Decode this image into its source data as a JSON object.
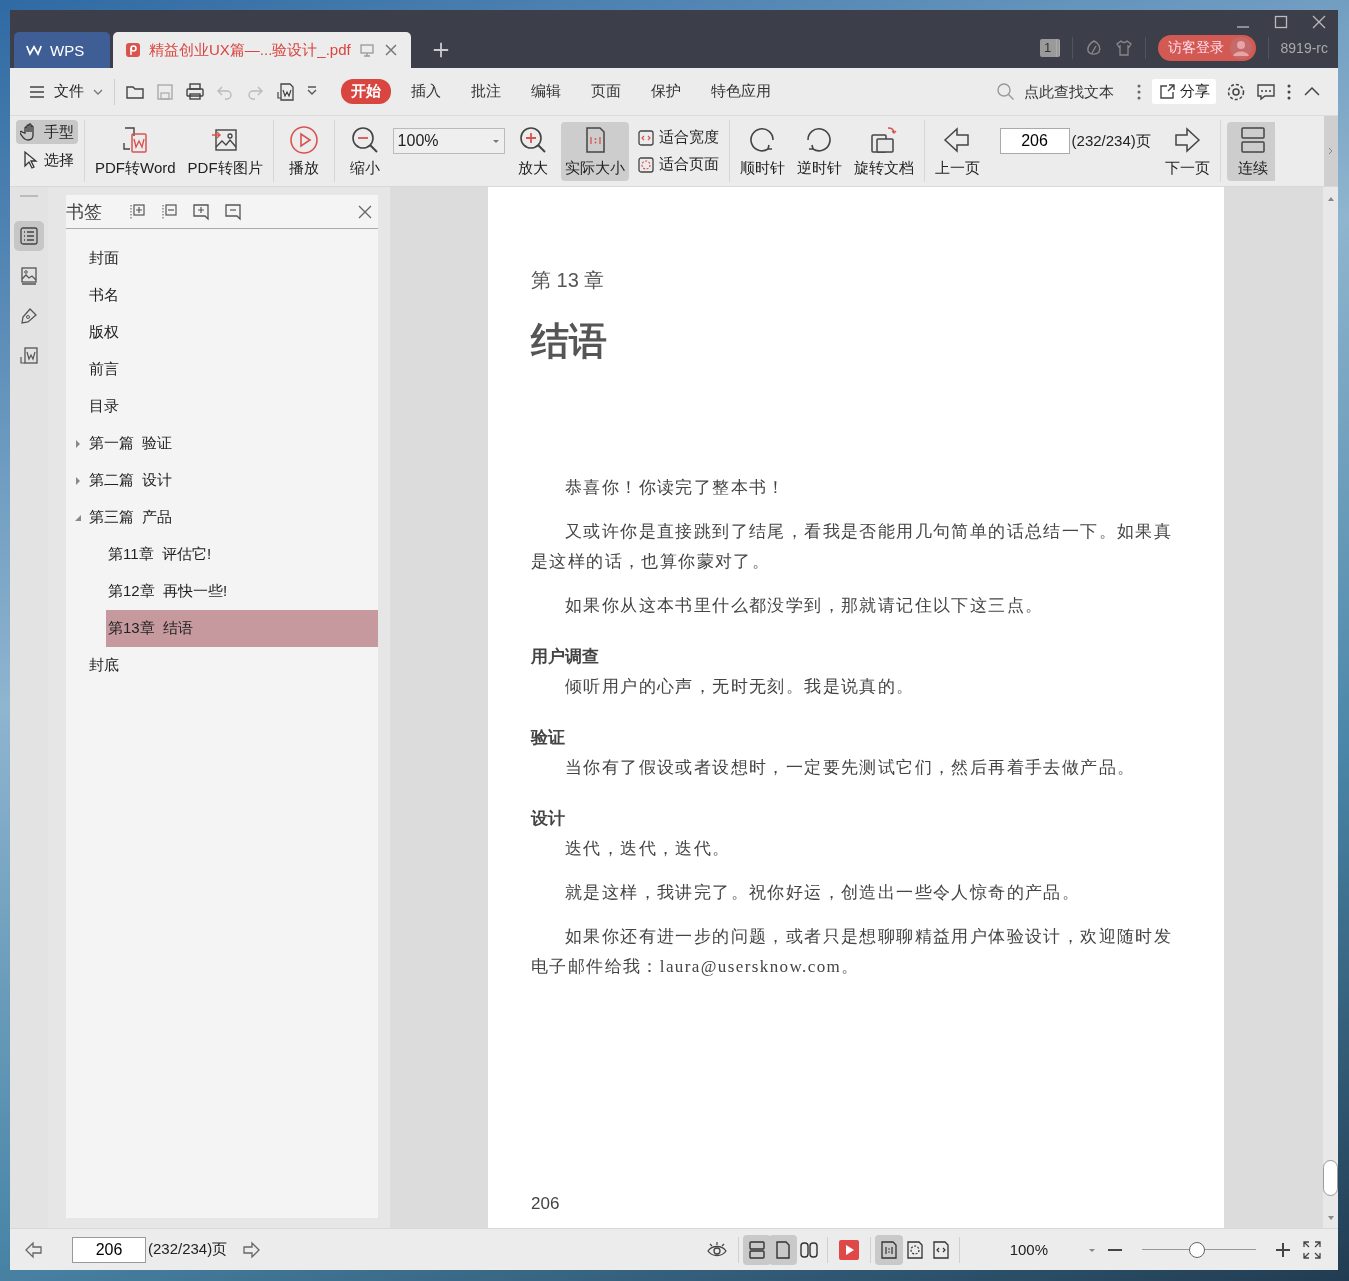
{
  "tabs": [
    {
      "kind": "home",
      "label": "WPS",
      "selected": false
    },
    {
      "kind": "doc",
      "label": "精益创业UX篇—...验设计_.pdf",
      "selected": true
    }
  ],
  "title_bar": {
    "page_count_badge": "1",
    "login": "访客登录",
    "user": "8919-rc"
  },
  "menu": {
    "file": "文件",
    "ribbon_tabs": [
      {
        "label": "开始",
        "selected": true
      },
      {
        "label": "插入",
        "selected": false
      },
      {
        "label": "批注",
        "selected": false
      },
      {
        "label": "编辑",
        "selected": false
      },
      {
        "label": "页面",
        "selected": false
      },
      {
        "label": "保护",
        "selected": false
      },
      {
        "label": "特色应用",
        "selected": false
      }
    ],
    "search": {
      "placeholder": "点此查找文本"
    },
    "share": "分享"
  },
  "toolbar": {
    "hand": {
      "label": "手型",
      "selected": true
    },
    "select": {
      "label": "选择",
      "selected": false
    },
    "pdf_to_word": "PDF转Word",
    "pdf_to_image": "PDF转图片",
    "play": "播放",
    "zoom_out": "缩小",
    "zoom_value": "100%",
    "zoom_in": "放大",
    "actual_size": {
      "label": "实际大小",
      "selected": true
    },
    "fit_width": "适合宽度",
    "fit_page": "适合页面",
    "clockwise": "顺时针",
    "counterclockwise": "逆时针",
    "rotate_document": "旋转文档",
    "prev_page": "上一页",
    "page_number": "206",
    "page_total": "(232/234)页",
    "next_page": "下一页",
    "continuous": {
      "label": "连续",
      "selected": true
    }
  },
  "side_rail": [
    {
      "selected": true
    },
    {
      "selected": false
    },
    {
      "selected": false
    },
    {
      "selected": false
    }
  ],
  "bookmarks": {
    "title": "书签",
    "items": [
      {
        "label": "封面",
        "selected": false
      },
      {
        "label": "书名",
        "selected": false
      },
      {
        "label": "版权",
        "selected": false
      },
      {
        "label": "前言",
        "selected": false
      },
      {
        "label": "目录",
        "selected": false
      },
      {
        "label": "第一篇  验证",
        "selected": false,
        "expanded": false
      },
      {
        "label": "第二篇  设计",
        "selected": false,
        "expanded": false
      },
      {
        "label": "第三篇  产品",
        "selected": false,
        "expanded": true,
        "children": [
          {
            "label": "第11章  评估它!",
            "selected": false
          },
          {
            "label": "第12章  再快一些!",
            "selected": false
          },
          {
            "label": "第13章  结语",
            "selected": true
          }
        ]
      },
      {
        "label": "封底",
        "selected": false
      }
    ]
  },
  "page": {
    "chapter": "第 13 章",
    "title": "结语",
    "blocks": [
      {
        "kind": "paragraph",
        "text": "恭喜你！你读完了整本书！"
      },
      {
        "kind": "paragraph",
        "text": "又或许你是直接跳到了结尾，看我是否能用几句简单的话总结一下。如果真是这样的话，也算你蒙对了。"
      },
      {
        "kind": "paragraph",
        "text": "如果你从这本书里什么都没学到，那就请记住以下这三点。"
      },
      {
        "kind": "heading",
        "text": "用户调查"
      },
      {
        "kind": "paragraph",
        "text": "倾听用户的心声，无时无刻。我是说真的。"
      },
      {
        "kind": "heading",
        "text": "验证"
      },
      {
        "kind": "paragraph",
        "text": "当你有了假设或者设想时，一定要先测试它们，然后再着手去做产品。"
      },
      {
        "kind": "heading",
        "text": "设计"
      },
      {
        "kind": "paragraph",
        "text": "迭代，迭代，迭代。"
      },
      {
        "kind": "paragraph",
        "text": "就是这样，我讲完了。祝你好运，创造出一些令人惊奇的产品。"
      },
      {
        "kind": "paragraph",
        "text": "如果你还有进一步的问题，或者只是想聊聊精益用户体验设计，欢迎随时发电子邮件给我：laura@usersknow.com。"
      }
    ],
    "page_number": "206"
  },
  "status_bar": {
    "page_number": "206",
    "page_total": "(232/234)页",
    "view_modes": [
      {
        "selected": true
      },
      {
        "selected": true
      },
      {
        "selected": false
      }
    ],
    "fit_modes": [
      {
        "selected": true
      },
      {
        "selected": false
      },
      {
        "selected": false
      }
    ],
    "zoom_value": "100%",
    "zoom": {
      "level": 0.48
    }
  }
}
